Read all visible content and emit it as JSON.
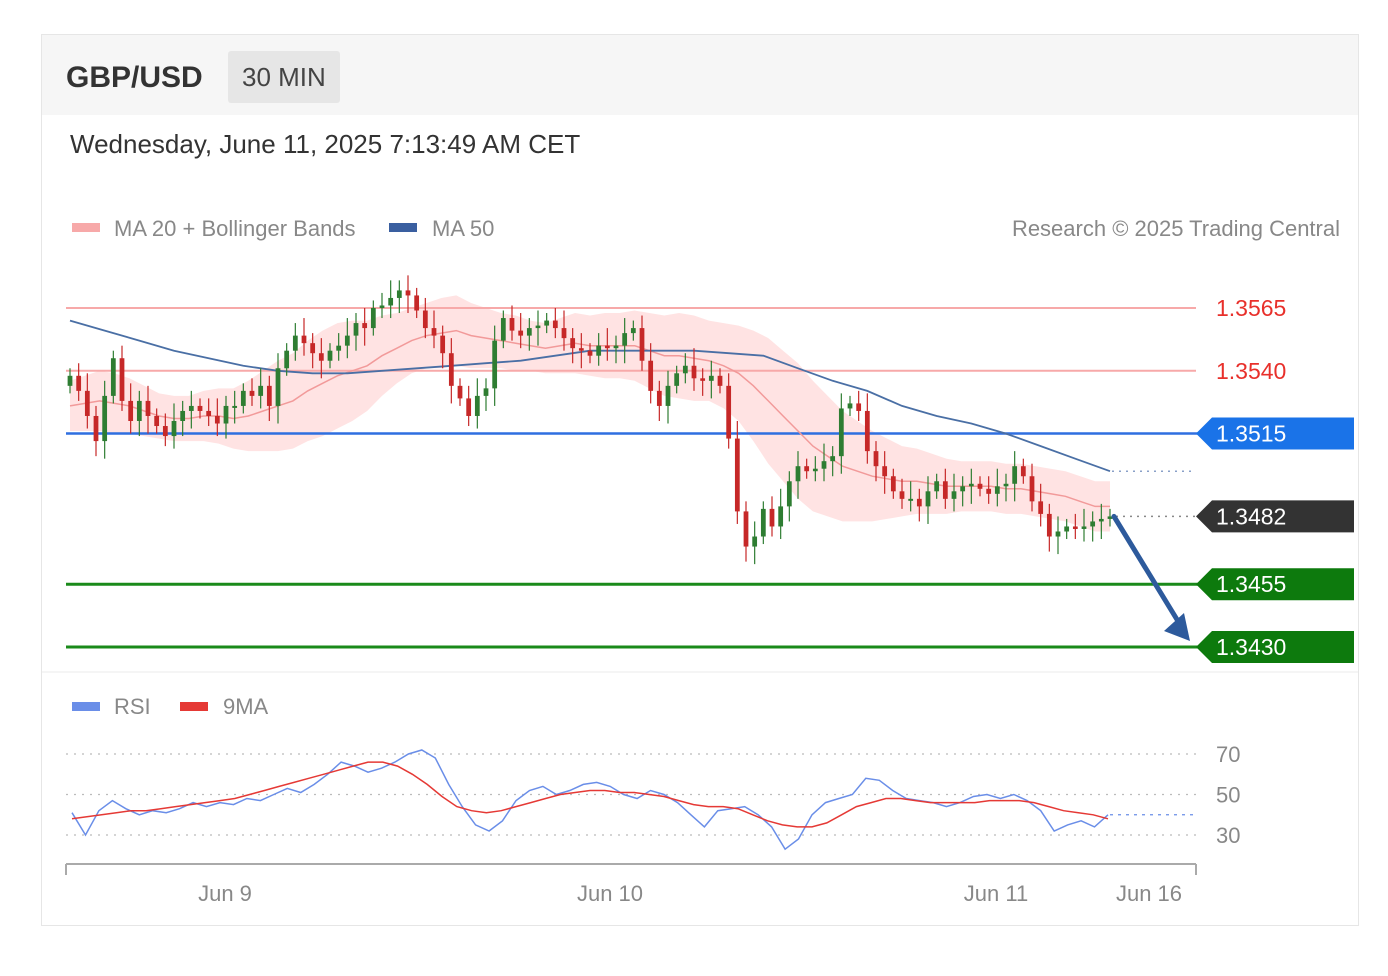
{
  "header": {
    "symbol": "GBP/USD",
    "timeframe": "30 MIN",
    "timestamp": "Wednesday, June 11, 2025 7:13:49 AM CET"
  },
  "credit": "Research © 2025 Trading Central",
  "colors": {
    "resistance": "#f7a9a9",
    "resistance_text": "#e8302b",
    "pivot": "#2f6fe0",
    "pivot_badge": "#1a73e8",
    "support": "#1a8a1a",
    "support_badge": "#0d7a0d",
    "last_price_badge": "#333333",
    "ma20_band": "#ffd9d9",
    "ma50": "#4a6fa5",
    "candle_up": "#2e7d32",
    "candle_down": "#c62828",
    "arrow": "#2d5a9c",
    "rsi": "#6a8ee8",
    "rsi_ma": "#e53935"
  },
  "chart_data": [
    {
      "type": "candlestick",
      "x_labels": [
        "Jun 9",
        "Jun 10",
        "Jun 11",
        "Jun 16"
      ],
      "legend": [
        {
          "name": "MA 20 + Bollinger Bands",
          "color": "#f7a9a9"
        },
        {
          "name": "MA 50",
          "color": "#3a5fa0"
        }
      ],
      "levels": [
        {
          "value": 1.3565,
          "label": "1.3565",
          "kind": "resistance"
        },
        {
          "value": 1.354,
          "label": "1.3540",
          "kind": "resistance"
        },
        {
          "value": 1.3515,
          "label": "1.3515",
          "kind": "pivot"
        },
        {
          "value": 1.3482,
          "label": "1.3482",
          "kind": "last"
        },
        {
          "value": 1.3455,
          "label": "1.3455",
          "kind": "support"
        },
        {
          "value": 1.343,
          "label": "1.3430",
          "kind": "support"
        }
      ],
      "close": [
        1.3538,
        1.3532,
        1.3522,
        1.3512,
        1.353,
        1.3545,
        1.3528,
        1.352,
        1.3528,
        1.3522,
        1.3518,
        1.3514,
        1.352,
        1.3524,
        1.3526,
        1.3524,
        1.3522,
        1.3519,
        1.3526,
        1.3526,
        1.3532,
        1.353,
        1.3534,
        1.3526,
        1.3541,
        1.3548,
        1.3554,
        1.3551,
        1.3547,
        1.3544,
        1.3548,
        1.355,
        1.3554,
        1.3559,
        1.3557,
        1.3565,
        1.3566,
        1.3569,
        1.3572,
        1.357,
        1.3564,
        1.3557,
        1.3554,
        1.3547,
        1.3534,
        1.3529,
        1.3522,
        1.353,
        1.3533,
        1.3552,
        1.3561,
        1.3556,
        1.3554,
        1.3557,
        1.3558,
        1.356,
        1.3557,
        1.3553,
        1.3549,
        1.3548,
        1.3546,
        1.355,
        1.3549,
        1.355,
        1.3555,
        1.3557,
        1.3544,
        1.3532,
        1.3526,
        1.3534,
        1.3539,
        1.3542,
        1.3537,
        1.3536,
        1.3538,
        1.3534,
        1.3513,
        1.3484,
        1.347,
        1.3474,
        1.3485,
        1.3478,
        1.3486,
        1.3496,
        1.3502,
        1.35,
        1.3501,
        1.3504,
        1.3506,
        1.3525,
        1.3527,
        1.3524,
        1.3508,
        1.3502,
        1.3498,
        1.3492,
        1.3489,
        1.3489,
        1.3486,
        1.3492,
        1.3496,
        1.3489,
        1.3492,
        1.3494,
        1.3495,
        1.3493,
        1.3491,
        1.3494,
        1.3495,
        1.3502,
        1.3498,
        1.3488,
        1.3483,
        1.3474,
        1.3476,
        1.3478,
        1.3477,
        1.3478,
        1.348,
        1.3481,
        1.3482
      ],
      "ma20": [
        1.3526,
        1.3527,
        1.3528,
        1.3527,
        1.3526,
        1.3524,
        1.3522,
        1.3521,
        1.3521,
        1.3522,
        1.3522,
        1.3521,
        1.3522,
        1.3524,
        1.3526,
        1.3528,
        1.3532,
        1.3535,
        1.3538,
        1.354,
        1.3542,
        1.3546,
        1.3549,
        1.3552,
        1.3554,
        1.3555,
        1.3556,
        1.3554,
        1.3553,
        1.3552,
        1.3551,
        1.355,
        1.3549,
        1.355,
        1.3551,
        1.355,
        1.355,
        1.355,
        1.355,
        1.3548,
        1.3546,
        1.3546,
        1.3545,
        1.3544,
        1.3542,
        1.3539,
        1.3534,
        1.3528,
        1.3522,
        1.3516,
        1.351,
        1.3506,
        1.3502,
        1.35,
        1.3498,
        1.3497,
        1.3496,
        1.3496,
        1.3495,
        1.3494,
        1.3494,
        1.3494,
        1.3494,
        1.3493,
        1.3493,
        1.3492,
        1.3491,
        1.349,
        1.3488,
        1.3486,
        1.3486
      ],
      "ma50": [
        1.356,
        1.3556,
        1.3552,
        1.3548,
        1.3545,
        1.3542,
        1.354,
        1.3539,
        1.3539,
        1.354,
        1.3541,
        1.3542,
        1.3543,
        1.3544,
        1.3546,
        1.3548,
        1.3548,
        1.3548,
        1.3548,
        1.3547,
        1.3546,
        1.3541,
        1.3536,
        1.3532,
        1.3526,
        1.3522,
        1.3519,
        1.3515,
        1.351,
        1.3505,
        1.35
      ],
      "forecast_arrow": {
        "from": 1.3482,
        "to": 1.343
      }
    },
    {
      "type": "line",
      "legend": [
        {
          "name": "RSI",
          "color": "#6a8ee8"
        },
        {
          "name": "9MA",
          "color": "#e53935"
        }
      ],
      "y_ticks": [
        70,
        50,
        30
      ],
      "rsi": [
        41,
        30,
        42,
        47,
        43,
        40,
        42,
        41,
        43,
        46,
        44,
        46,
        45,
        48,
        47,
        50,
        53,
        51,
        55,
        60,
        66,
        64,
        61,
        63,
        66,
        70,
        72,
        68,
        55,
        44,
        35,
        32,
        37,
        47,
        52,
        54,
        50,
        52,
        55,
        56,
        54,
        50,
        48,
        52,
        50,
        46,
        40,
        34,
        42,
        43,
        44,
        40,
        34,
        23,
        28,
        40,
        46,
        48,
        50,
        58,
        57,
        52,
        48,
        47,
        46,
        44,
        46,
        49,
        50,
        48,
        50,
        47,
        42,
        32,
        35,
        37,
        34,
        40
      ],
      "rsi_ma": [
        38,
        39,
        40,
        41,
        42,
        42,
        43,
        44,
        45,
        46,
        47,
        48,
        50,
        52,
        54,
        56,
        58,
        60,
        62,
        64,
        66,
        66,
        64,
        60,
        55,
        49,
        44,
        42,
        41,
        42,
        44,
        46,
        48,
        50,
        51,
        52,
        52,
        51,
        51,
        50,
        49,
        47,
        45,
        44,
        44,
        43,
        40,
        37,
        35,
        34,
        34,
        36,
        40,
        44,
        46,
        48,
        48,
        47,
        46,
        46,
        46,
        46,
        47,
        47,
        47,
        46,
        44,
        42,
        41,
        40,
        38
      ]
    }
  ]
}
